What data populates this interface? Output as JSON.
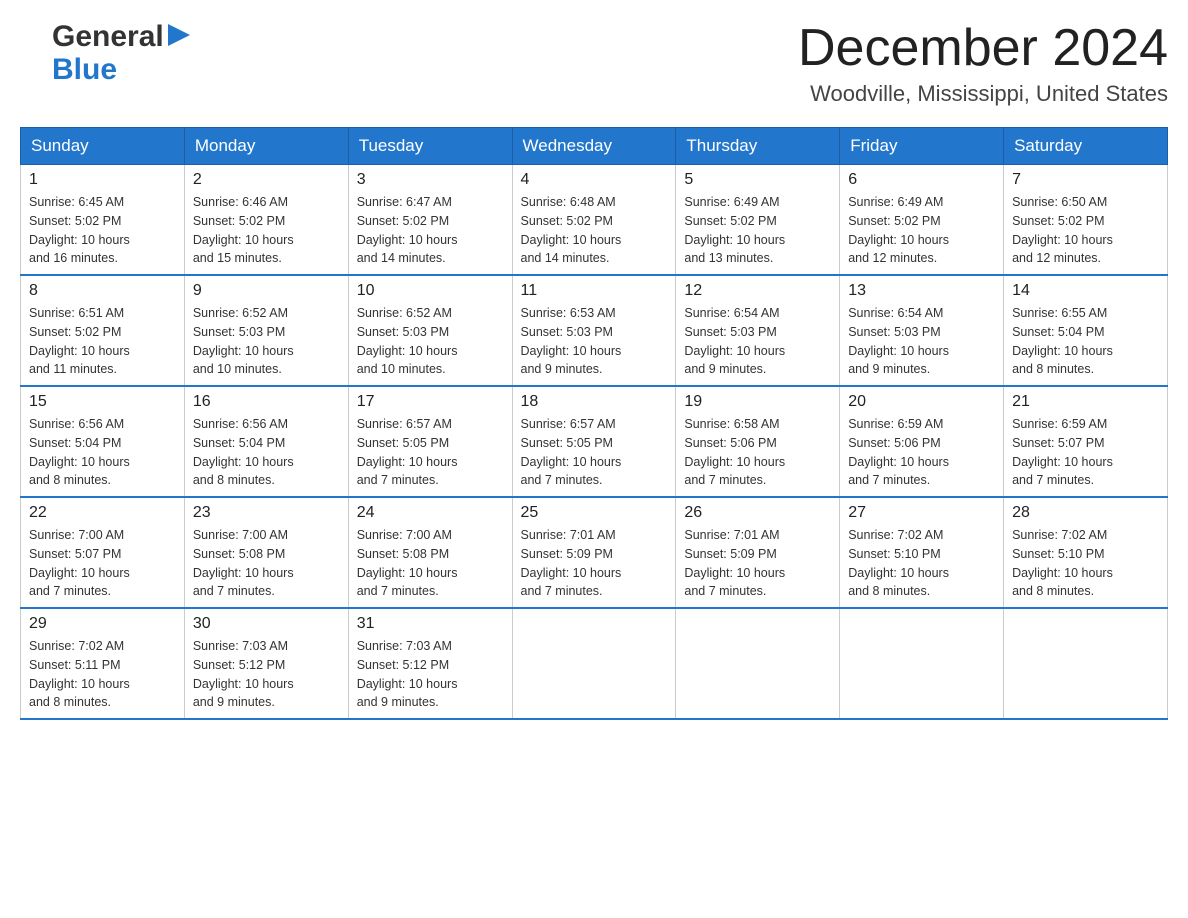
{
  "header": {
    "logo": {
      "general": "General",
      "blue": "Blue",
      "logo_alt": "GeneralBlue logo"
    },
    "title": "December 2024",
    "location": "Woodville, Mississippi, United States"
  },
  "days_of_week": [
    "Sunday",
    "Monday",
    "Tuesday",
    "Wednesday",
    "Thursday",
    "Friday",
    "Saturday"
  ],
  "weeks": [
    [
      {
        "day": "1",
        "sunrise": "6:45 AM",
        "sunset": "5:02 PM",
        "daylight": "10 hours and 16 minutes."
      },
      {
        "day": "2",
        "sunrise": "6:46 AM",
        "sunset": "5:02 PM",
        "daylight": "10 hours and 15 minutes."
      },
      {
        "day": "3",
        "sunrise": "6:47 AM",
        "sunset": "5:02 PM",
        "daylight": "10 hours and 14 minutes."
      },
      {
        "day": "4",
        "sunrise": "6:48 AM",
        "sunset": "5:02 PM",
        "daylight": "10 hours and 14 minutes."
      },
      {
        "day": "5",
        "sunrise": "6:49 AM",
        "sunset": "5:02 PM",
        "daylight": "10 hours and 13 minutes."
      },
      {
        "day": "6",
        "sunrise": "6:49 AM",
        "sunset": "5:02 PM",
        "daylight": "10 hours and 12 minutes."
      },
      {
        "day": "7",
        "sunrise": "6:50 AM",
        "sunset": "5:02 PM",
        "daylight": "10 hours and 12 minutes."
      }
    ],
    [
      {
        "day": "8",
        "sunrise": "6:51 AM",
        "sunset": "5:02 PM",
        "daylight": "10 hours and 11 minutes."
      },
      {
        "day": "9",
        "sunrise": "6:52 AM",
        "sunset": "5:03 PM",
        "daylight": "10 hours and 10 minutes."
      },
      {
        "day": "10",
        "sunrise": "6:52 AM",
        "sunset": "5:03 PM",
        "daylight": "10 hours and 10 minutes."
      },
      {
        "day": "11",
        "sunrise": "6:53 AM",
        "sunset": "5:03 PM",
        "daylight": "10 hours and 9 minutes."
      },
      {
        "day": "12",
        "sunrise": "6:54 AM",
        "sunset": "5:03 PM",
        "daylight": "10 hours and 9 minutes."
      },
      {
        "day": "13",
        "sunrise": "6:54 AM",
        "sunset": "5:03 PM",
        "daylight": "10 hours and 9 minutes."
      },
      {
        "day": "14",
        "sunrise": "6:55 AM",
        "sunset": "5:04 PM",
        "daylight": "10 hours and 8 minutes."
      }
    ],
    [
      {
        "day": "15",
        "sunrise": "6:56 AM",
        "sunset": "5:04 PM",
        "daylight": "10 hours and 8 minutes."
      },
      {
        "day": "16",
        "sunrise": "6:56 AM",
        "sunset": "5:04 PM",
        "daylight": "10 hours and 8 minutes."
      },
      {
        "day": "17",
        "sunrise": "6:57 AM",
        "sunset": "5:05 PM",
        "daylight": "10 hours and 7 minutes."
      },
      {
        "day": "18",
        "sunrise": "6:57 AM",
        "sunset": "5:05 PM",
        "daylight": "10 hours and 7 minutes."
      },
      {
        "day": "19",
        "sunrise": "6:58 AM",
        "sunset": "5:06 PM",
        "daylight": "10 hours and 7 minutes."
      },
      {
        "day": "20",
        "sunrise": "6:59 AM",
        "sunset": "5:06 PM",
        "daylight": "10 hours and 7 minutes."
      },
      {
        "day": "21",
        "sunrise": "6:59 AM",
        "sunset": "5:07 PM",
        "daylight": "10 hours and 7 minutes."
      }
    ],
    [
      {
        "day": "22",
        "sunrise": "7:00 AM",
        "sunset": "5:07 PM",
        "daylight": "10 hours and 7 minutes."
      },
      {
        "day": "23",
        "sunrise": "7:00 AM",
        "sunset": "5:08 PM",
        "daylight": "10 hours and 7 minutes."
      },
      {
        "day": "24",
        "sunrise": "7:00 AM",
        "sunset": "5:08 PM",
        "daylight": "10 hours and 7 minutes."
      },
      {
        "day": "25",
        "sunrise": "7:01 AM",
        "sunset": "5:09 PM",
        "daylight": "10 hours and 7 minutes."
      },
      {
        "day": "26",
        "sunrise": "7:01 AM",
        "sunset": "5:09 PM",
        "daylight": "10 hours and 7 minutes."
      },
      {
        "day": "27",
        "sunrise": "7:02 AM",
        "sunset": "5:10 PM",
        "daylight": "10 hours and 8 minutes."
      },
      {
        "day": "28",
        "sunrise": "7:02 AM",
        "sunset": "5:10 PM",
        "daylight": "10 hours and 8 minutes."
      }
    ],
    [
      {
        "day": "29",
        "sunrise": "7:02 AM",
        "sunset": "5:11 PM",
        "daylight": "10 hours and 8 minutes."
      },
      {
        "day": "30",
        "sunrise": "7:03 AM",
        "sunset": "5:12 PM",
        "daylight": "10 hours and 9 minutes."
      },
      {
        "day": "31",
        "sunrise": "7:03 AM",
        "sunset": "5:12 PM",
        "daylight": "10 hours and 9 minutes."
      },
      null,
      null,
      null,
      null
    ]
  ],
  "labels": {
    "sunrise": "Sunrise:",
    "sunset": "Sunset:",
    "daylight": "Daylight:"
  }
}
